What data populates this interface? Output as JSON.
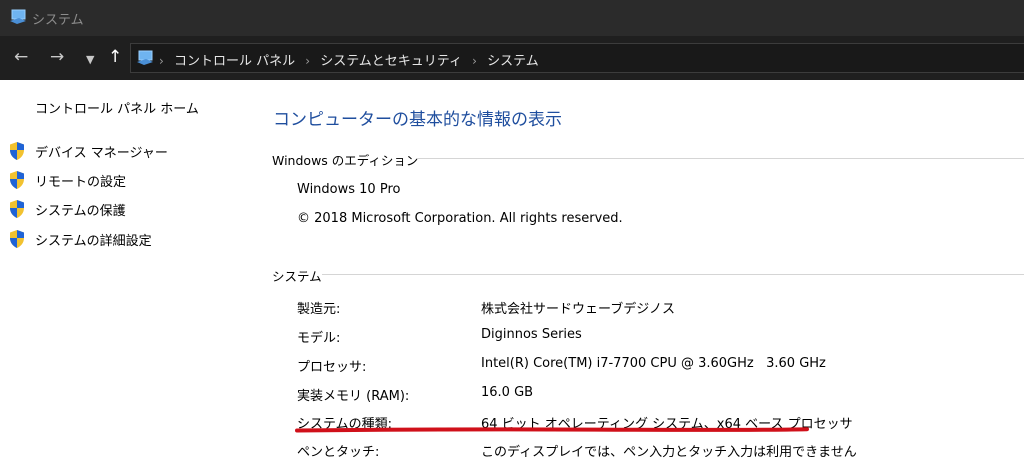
{
  "window": {
    "title": "システム"
  },
  "nav": {
    "back": "←",
    "forward": "→",
    "recent": "⌄",
    "up": "↑",
    "breadcrumb": [
      "コントロール パネル",
      "システムとセキュリティ",
      "システム"
    ],
    "separator": "›"
  },
  "sidebar": {
    "home": "コントロール パネル ホーム",
    "tasks": [
      {
        "label": "デバイス マネージャー",
        "icon": "uac-shield-icon"
      },
      {
        "label": "リモートの設定",
        "icon": "uac-shield-icon"
      },
      {
        "label": "システムの保護",
        "icon": "uac-shield-icon"
      },
      {
        "label": "システムの詳細設定",
        "icon": "uac-shield-icon"
      }
    ]
  },
  "main": {
    "heading": "コンピューターの基本的な情報の表示",
    "edition": {
      "title": "Windows のエディション",
      "name": "Windows 10 Pro",
      "copyright": "© 2018 Microsoft Corporation. All rights reserved."
    },
    "system": {
      "title": "システム",
      "rows": [
        {
          "label": "製造元:",
          "value": "株式会社サードウェーブデジノス"
        },
        {
          "label": "モデル:",
          "value": "Diginnos Series"
        },
        {
          "label": "プロセッサ:",
          "value": "Intel(R) Core(TM) i7-7700 CPU @ 3.60GHz   3.60 GHz"
        },
        {
          "label": "実装メモリ (RAM):",
          "value": "16.0 GB"
        },
        {
          "label": "システムの種類:",
          "value": "64 ビット オペレーティング システム、x64 ベース プロセッサ"
        },
        {
          "label": "ペンとタッチ:",
          "value": "このディスプレイでは、ペン入力とタッチ入力は利用できません"
        }
      ]
    }
  },
  "colors": {
    "titlebar": "#2b2b2b",
    "navbar": "#1f1f1f",
    "heading": "#1f4e9e",
    "highlight_underline": "#d0101a"
  }
}
